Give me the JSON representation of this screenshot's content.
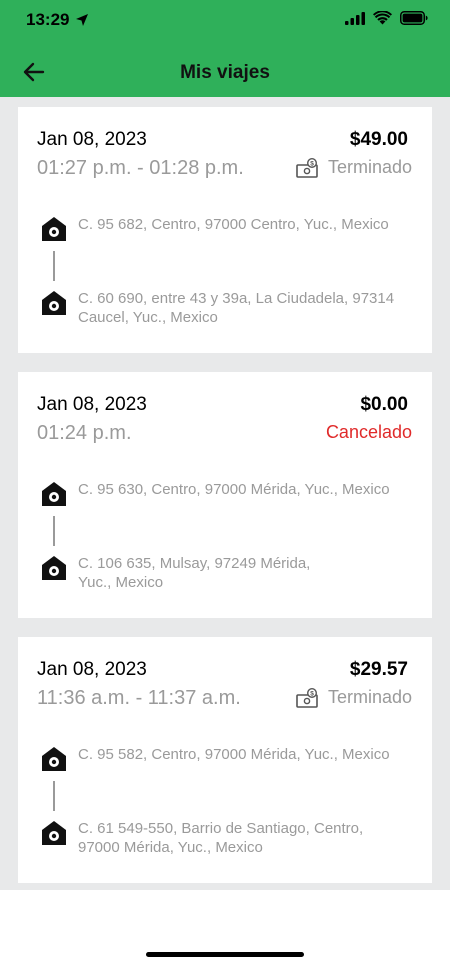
{
  "status_bar": {
    "time": "13:29"
  },
  "header": {
    "title": "Mis viajes"
  },
  "trips": [
    {
      "date": "Jan 08, 2023",
      "price": "$49.00",
      "time": "01:27 p.m. - 01:28 p.m.",
      "status": "Terminado",
      "origin": "C. 95 682, Centro, 97000 Centro, Yuc., Mexico",
      "destination_line1": "C. 60 690, entre 43 y 39a, La Ciudadela, 97314",
      "destination_line2": "Caucel, Yuc., Mexico"
    },
    {
      "date": "Jan 08, 2023",
      "price": "$0.00",
      "time": "01:24 p.m.",
      "status": "Cancelado",
      "origin": "C. 95 630, Centro, 97000 Mérida, Yuc., Mexico",
      "destination_line1": "C. 106 635, Mulsay, 97249 Mérida,",
      "destination_line2": "Yuc., Mexico"
    },
    {
      "date": "Jan 08, 2023",
      "price": "$29.57",
      "time": "11:36 a.m. - 11:37 a.m.",
      "status": "Terminado",
      "origin": "C. 95 582, Centro, 97000 Mérida, Yuc., Mexico",
      "destination_line1": "C. 61 549-550, Barrio de Santiago, Centro,",
      "destination_line2": "97000 Mérida, Yuc., Mexico"
    }
  ],
  "colors": {
    "header_green": "#2fb05a",
    "cancel_red": "#e02a2a",
    "muted_gray": "#9a9a9a"
  }
}
